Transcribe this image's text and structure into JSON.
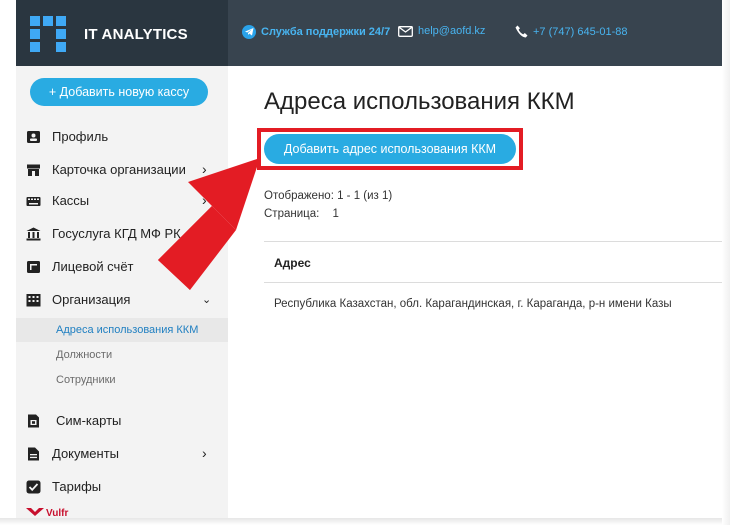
{
  "brand": {
    "name": "IT ANALYTICS",
    "accent": "#3fa9f5",
    "header_bg": "#2a3640"
  },
  "topbar": {
    "support": "Служба поддержки 24/7",
    "email": "help@aofd.kz",
    "phone": "+7 (747) 645-01-88"
  },
  "sidebar": {
    "add_button": "+ Добавить новую кассу",
    "items": [
      {
        "label": "Профиль",
        "icon": "id-badge-icon"
      },
      {
        "label": "Карточка организации",
        "icon": "storefront-icon"
      },
      {
        "label": "Кассы",
        "icon": "keyboard-icon"
      },
      {
        "label": "Госуслуга КГД МФ РК",
        "icon": "government-building-icon"
      },
      {
        "label": "Лицевой счёт",
        "icon": "account-card-icon"
      },
      {
        "label": "Организация",
        "icon": "building-icon"
      },
      {
        "label": "Сим-карты",
        "icon": "sim-card-icon"
      },
      {
        "label": "Документы",
        "icon": "document-icon"
      },
      {
        "label": "Тарифы",
        "icon": "checkbox-icon"
      }
    ],
    "submenu": [
      "Адреса использования ККМ",
      "Должности",
      "Сотрудники"
    ],
    "bottom_logo": "Vulfr ТИС"
  },
  "main": {
    "title": "Адреса использования ККМ",
    "add_button": "Добавить адрес использования ККМ",
    "shown": "Отображено: 1 - 1 (из 1)",
    "page_label": "Страница:",
    "page_value": "1",
    "table": {
      "header": "Адрес",
      "rows": [
        "Республика Казахстан, обл. Карагандинская, г. Караганда, р-н имени Казы"
      ]
    }
  },
  "colors": {
    "button": "#29abe2",
    "highlight": "#e31c24",
    "active_link": "#1f7fc1"
  }
}
